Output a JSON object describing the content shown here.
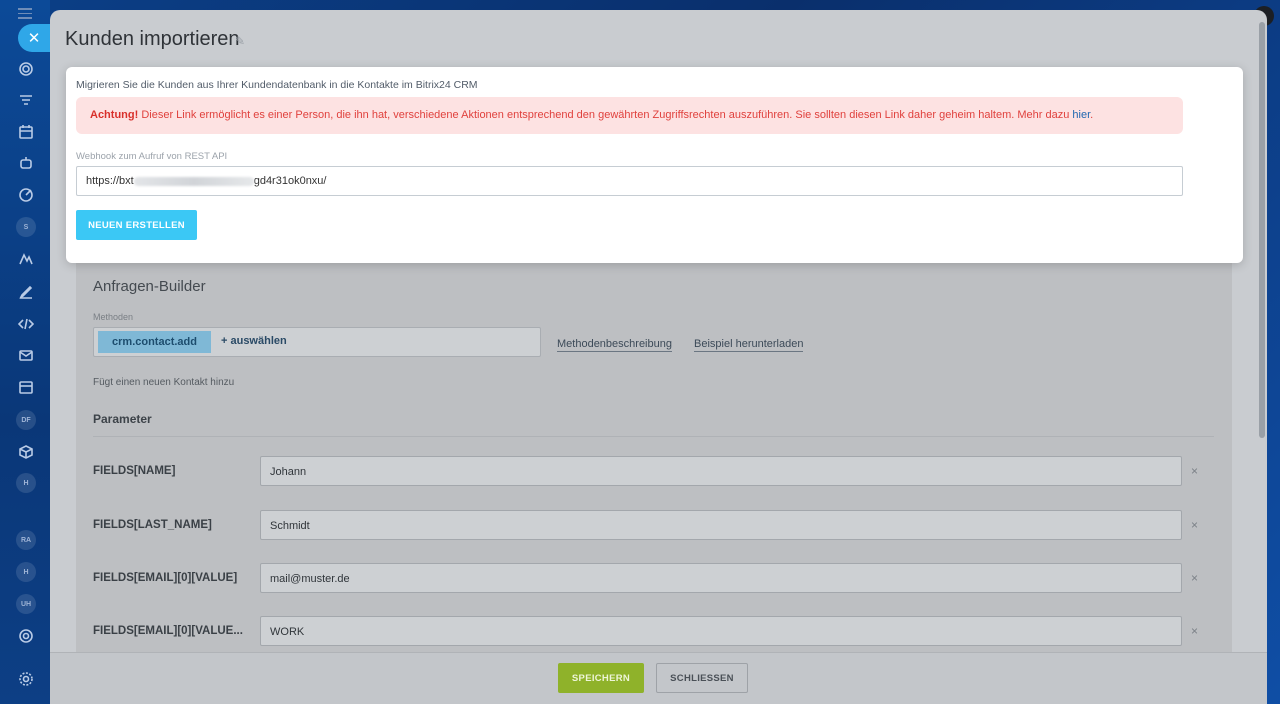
{
  "slider": {
    "title": "Kunden importieren",
    "close_glyph": "✕",
    "pencil_glyph": "✎"
  },
  "modal": {
    "intro": "Migrieren Sie die Kunden aus Ihrer Kundendatenbank in die Kontakte im Bitrix24 CRM",
    "alert_strong": "Achtung!",
    "alert_text": " Dieser Link ermöglicht es einer Person, die ihn hat, verschiedene Aktionen entsprechend den gewährten Zugriffsrechten auszuführen. Sie sollten diesen Link daher geheim haltem. Mehr dazu ",
    "alert_link": "hier",
    "alert_end": ".",
    "webhook_label": "Webhook zum Aufruf von REST API",
    "webhook_prefix": "https://bxt",
    "webhook_suffix": "gd4r31ok0nxu/",
    "new_button": "NEUEN ERSTELLEN"
  },
  "builder": {
    "title": "Anfragen-Builder",
    "methods_label": "Methoden",
    "method_chip": "crm.contact.add",
    "method_add": "+  auswählen",
    "doc_link": "Methodenbeschreibung",
    "example_link": "Beispiel herunterladen",
    "method_description": "Fügt einen neuen Kontakt hinzu",
    "parameters_title": "Parameter",
    "remove_glyph": "×",
    "params": [
      {
        "name": "FIELDS[NAME]",
        "value": "Johann"
      },
      {
        "name": "FIELDS[LAST_NAME]",
        "value": "Schmidt"
      },
      {
        "name": "FIELDS[EMAIL][0][VALUE]",
        "value": "mail@muster.de"
      },
      {
        "name": "FIELDS[EMAIL][0][VALUE...",
        "value": "WORK"
      }
    ]
  },
  "footer": {
    "save": "SPEICHERN",
    "close": "SCHLIESSEN"
  },
  "rail": {
    "avatars": [
      "S",
      "DF",
      "H",
      "RA",
      "H",
      "UH"
    ]
  },
  "colors": {
    "accent_blue": "#3bc8f5",
    "save_green": "#8fb22a",
    "alert_red": "#e0413d"
  }
}
